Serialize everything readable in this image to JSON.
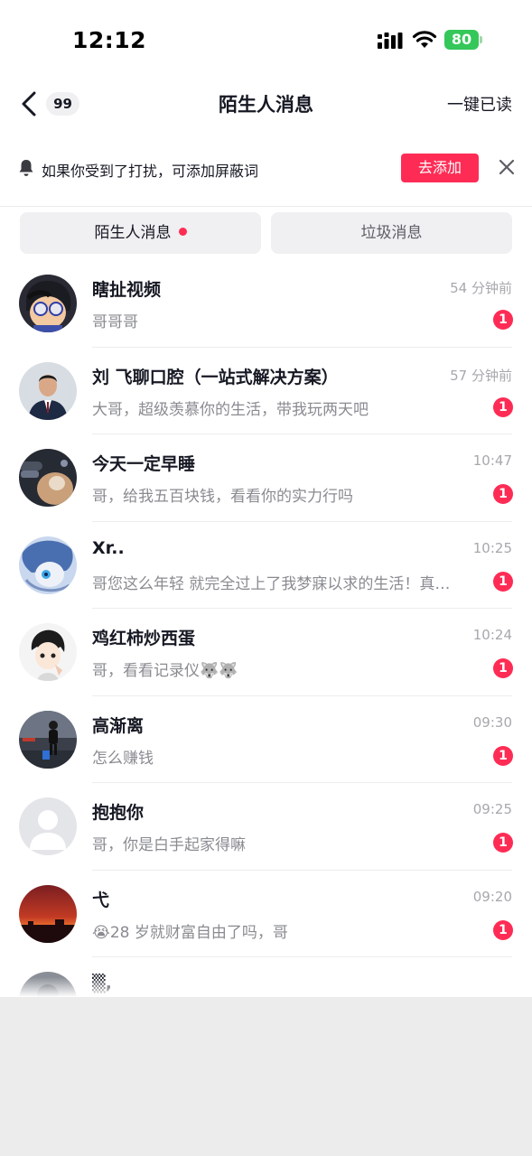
{
  "status_bar": {
    "time": "12:12",
    "battery": "80"
  },
  "header": {
    "back_count": "99",
    "title": "陌生人消息",
    "mark_all_read": "一键已读"
  },
  "notice": {
    "text": "如果你受到了打扰，可添加屏蔽词",
    "add_button": "去添加"
  },
  "tabs": [
    {
      "label": "陌生人消息",
      "active": true,
      "has_dot": true
    },
    {
      "label": "垃圾消息",
      "active": false
    }
  ],
  "messages": [
    {
      "name": "瞎扯视频",
      "preview": "哥哥哥",
      "time": "54 分钟前",
      "unread": "1"
    },
    {
      "name": "刘 飞聊口腔（一站式解决方案）",
      "preview": "大哥，超级羡慕你的生活，带我玩两天吧",
      "time": "57 分钟前",
      "unread": "1"
    },
    {
      "name": "今天一定早睡",
      "preview": "哥，给我五百块钱，看看你的实力行吗",
      "time": "10:47",
      "unread": "1"
    },
    {
      "name": "Xr..",
      "preview": "哥您这么年轻 就完全过上了我梦寐以求的生活！真…",
      "time": "10:25",
      "unread": "1"
    },
    {
      "name": "鸡红柿炒西蛋",
      "preview": "哥，看看记录仪🐺🐺",
      "time": "10:24",
      "unread": "1"
    },
    {
      "name": "高渐离",
      "preview": "怎么赚钱",
      "time": "09:30",
      "unread": "1"
    },
    {
      "name": "抱抱你",
      "preview": "哥，你是白手起家得嘛",
      "time": "09:25",
      "unread": "1"
    },
    {
      "name": "弋",
      "preview": "😭28 岁就财富自由了吗，哥",
      "time": "09:20",
      "unread": "1"
    }
  ],
  "partial_message": {
    "name": "▒,"
  },
  "colors": {
    "accent": "#fe2c55",
    "battery": "#34c759",
    "muted_text": "#8a8b91"
  }
}
